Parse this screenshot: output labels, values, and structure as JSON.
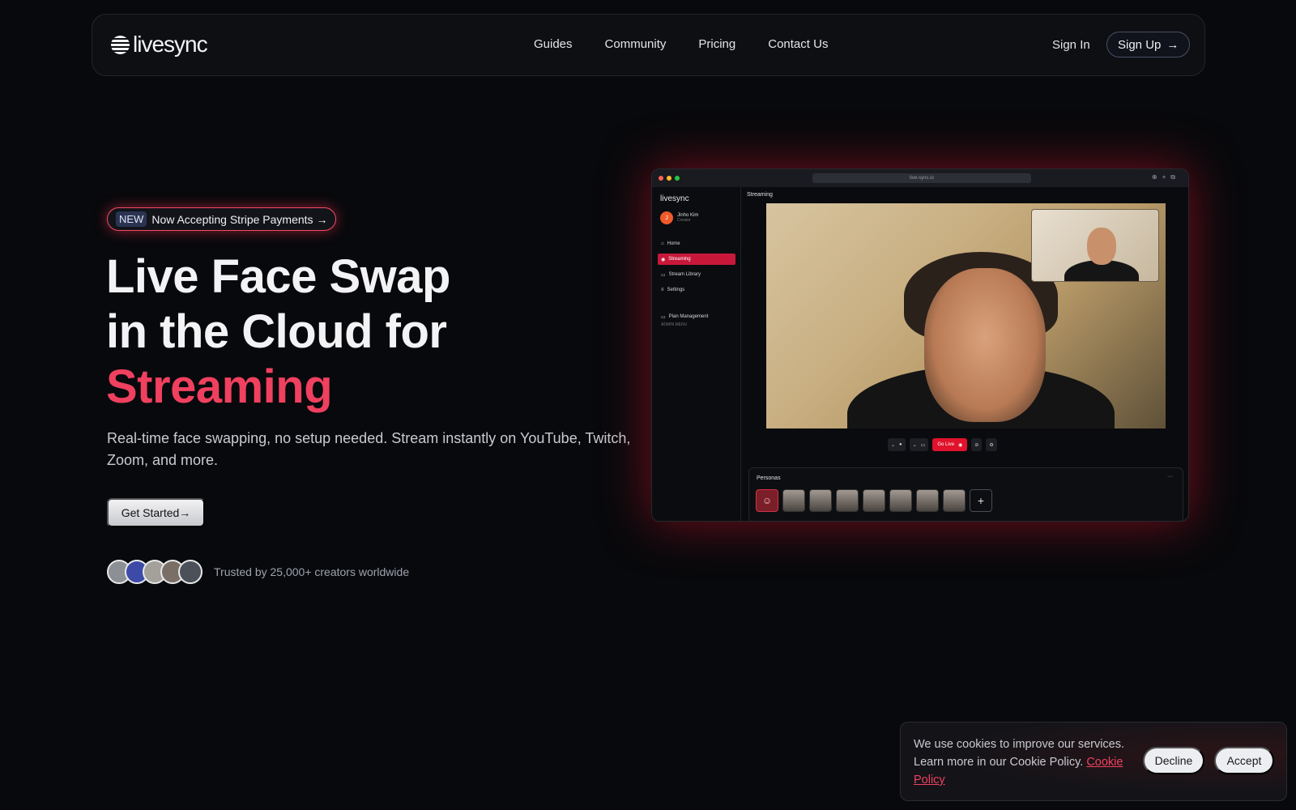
{
  "brand": {
    "name": "livesync"
  },
  "nav": {
    "links": [
      "Guides",
      "Community",
      "Pricing",
      "Contact Us"
    ],
    "sign_in": "Sign In",
    "sign_up": "Sign Up",
    "arrow": "→"
  },
  "hero": {
    "badge_tag": "NEW",
    "badge_text": "Now Accepting Stripe Payments →",
    "title_line1": "Live Face Swap",
    "title_line2": "in the Cloud for",
    "title_accent": "Streaming",
    "subtitle": "Real-time face swapping, no setup needed. Stream instantly on YouTube, Twitch, Zoom, and more.",
    "cta": "Get Started→",
    "trust_text": "Trusted by 25,000+ creators worldwide"
  },
  "app_preview": {
    "url": "live-sync.io",
    "logo": "livesync",
    "user_name": "Jinho Kim",
    "user_role": "Creator",
    "user_initial": "J",
    "sidebar": [
      "Home",
      "Streaming",
      "Stream Library",
      "Settings"
    ],
    "admin_label": "ADMIN MENU",
    "admin_item": "Plan Management",
    "page_title": "Streaming",
    "go_live": "Go Live",
    "personas_title": "Personas",
    "personas_more": "···"
  },
  "cookie": {
    "text": "We use cookies to improve our services. Learn more in our Cookie Policy.",
    "link": "Cookie Policy",
    "decline": "Decline",
    "accept": "Accept"
  },
  "colors": {
    "accent": "#f0405f",
    "live": "#e0122c",
    "background": "#08090c"
  }
}
